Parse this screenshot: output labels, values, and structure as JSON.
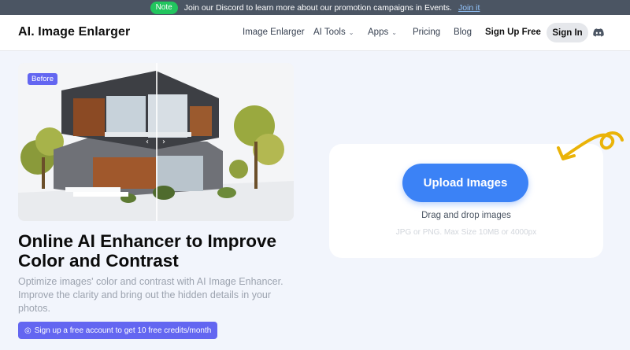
{
  "announcement": {
    "badge": "Note",
    "text": "Join our Discord to learn more about our promotion campaigns in Events.",
    "link": "Join it"
  },
  "header": {
    "logo": "AI. Image Enlarger",
    "nav": [
      {
        "label": "Image Enlarger",
        "dropdown": false
      },
      {
        "label": "AI Tools",
        "dropdown": true
      },
      {
        "label": "Apps",
        "dropdown": true
      },
      {
        "label": "Pricing",
        "dropdown": false
      },
      {
        "label": "Blog",
        "dropdown": false
      }
    ],
    "signup": "Sign Up Free",
    "signin": "Sign In",
    "discord_icon": "discord-icon"
  },
  "hero": {
    "before_badge": "Before",
    "heading": "Online AI Enhancer to Improve Color and Contrast",
    "description": "Optimize images' color and contrast with AI Image Enhancer. Improve the clarity and bring out the hidden details in your photos.",
    "cta": "Sign up a free account to get 10 free credits/month"
  },
  "upload": {
    "button": "Upload Images",
    "drag": "Drag and drop images",
    "limits": "JPG or PNG. Max Size 10MB or 4000px"
  },
  "colors": {
    "accent": "#6366f1",
    "primary": "#3b82f6",
    "announcement_bg": "#4b5563",
    "note": "#22c55e",
    "doodle": "#eab308"
  }
}
